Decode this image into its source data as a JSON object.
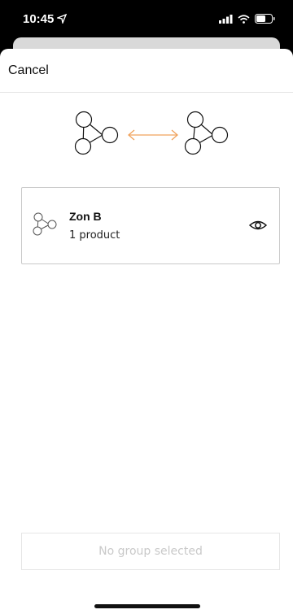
{
  "status_bar": {
    "time": "10:45",
    "icons": [
      "location-arrow-icon",
      "signal-icon",
      "wifi-icon",
      "battery-icon"
    ]
  },
  "nav": {
    "cancel_label": "Cancel"
  },
  "hero": {
    "left_icon": "group-nodes-icon",
    "arrow_icon": "double-arrow-icon",
    "right_icon": "group-nodes-icon",
    "arrow_color": "#f0a25c"
  },
  "group_card": {
    "title": "Zon B",
    "subtitle": "1 product",
    "icon": "group-nodes-icon",
    "action_icon": "eye-icon"
  },
  "footer": {
    "button_label": "No group selected"
  }
}
